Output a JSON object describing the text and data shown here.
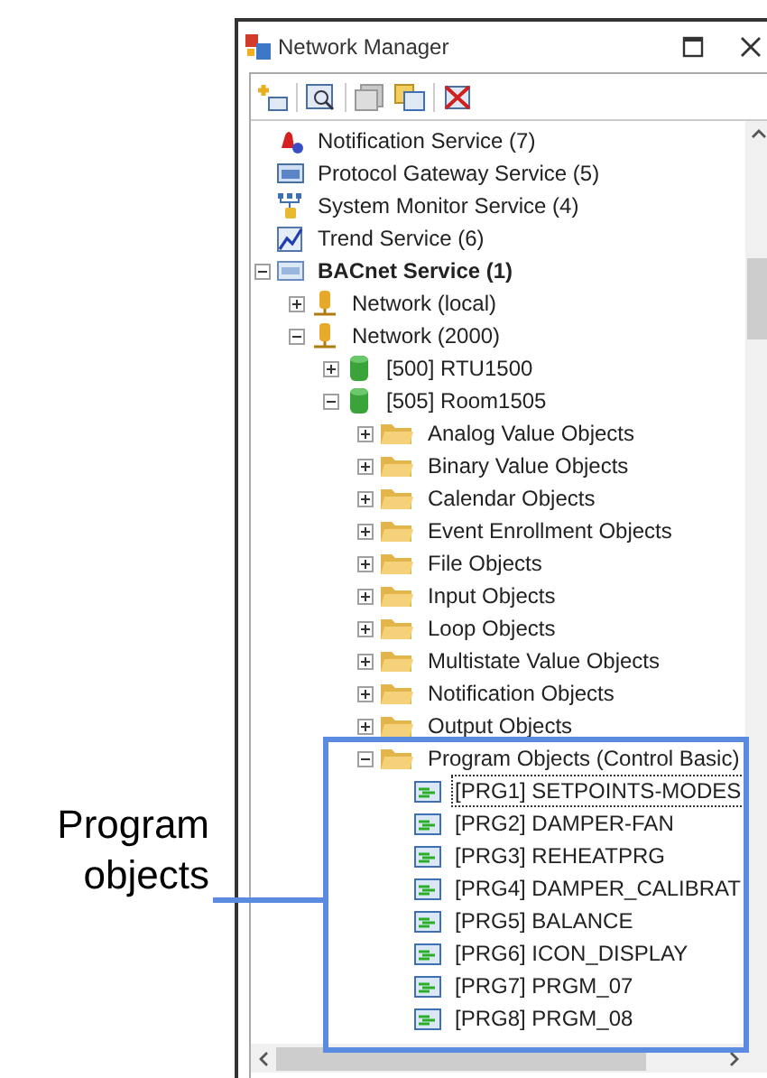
{
  "window": {
    "title": "Network Manager"
  },
  "tree": [
    {
      "label": "Notification Service (7)",
      "kind": "notification",
      "bold": false
    },
    {
      "label": "Protocol Gateway Service (5)",
      "kind": "gateway",
      "bold": false
    },
    {
      "label": "System Monitor Service (4)",
      "kind": "monitor",
      "bold": false
    },
    {
      "label": "Trend Service (6)",
      "kind": "trend",
      "bold": false
    },
    {
      "label": "BACnet Service (1)",
      "kind": "bacnet",
      "bold": true,
      "expanded": true,
      "children": [
        {
          "label": "Network (local)",
          "kind": "network",
          "expanded": false
        },
        {
          "label": "Network (2000)",
          "kind": "network",
          "expanded": true,
          "children": [
            {
              "label": "[500] RTU1500",
              "kind": "device",
              "expanded": false
            },
            {
              "label": "[505] Room1505",
              "kind": "device",
              "expanded": true,
              "children": [
                {
                  "label": "Analog Value Objects",
                  "kind": "folder",
                  "expanded": false
                },
                {
                  "label": "Binary Value Objects",
                  "kind": "folder",
                  "expanded": false
                },
                {
                  "label": "Calendar Objects",
                  "kind": "folder",
                  "expanded": false
                },
                {
                  "label": "Event Enrollment Objects",
                  "kind": "folder",
                  "expanded": false
                },
                {
                  "label": "File Objects",
                  "kind": "folder",
                  "expanded": false
                },
                {
                  "label": "Input Objects",
                  "kind": "folder",
                  "expanded": false
                },
                {
                  "label": "Loop Objects",
                  "kind": "folder",
                  "expanded": false
                },
                {
                  "label": "Multistate Value Objects",
                  "kind": "folder",
                  "expanded": false
                },
                {
                  "label": "Notification Objects",
                  "kind": "folder",
                  "expanded": false
                },
                {
                  "label": "Output Objects",
                  "kind": "folder",
                  "expanded": false
                },
                {
                  "label": "Program Objects (Control Basic)",
                  "kind": "folder",
                  "expanded": true,
                  "children": [
                    {
                      "label": "[PRG1] SETPOINTS-MODES",
                      "kind": "program",
                      "selected": true
                    },
                    {
                      "label": "[PRG2] DAMPER-FAN",
                      "kind": "program",
                      "selected": false
                    },
                    {
                      "label": "[PRG3] REHEATPRG",
                      "kind": "program",
                      "selected": false
                    },
                    {
                      "label": "[PRG4] DAMPER_CALIBRAT",
                      "kind": "program",
                      "selected": false
                    },
                    {
                      "label": "[PRG5] BALANCE",
                      "kind": "program",
                      "selected": false
                    },
                    {
                      "label": "[PRG6] ICON_DISPLAY",
                      "kind": "program",
                      "selected": false
                    },
                    {
                      "label": "[PRG7] PRGM_07",
                      "kind": "program",
                      "selected": false
                    },
                    {
                      "label": "[PRG8] PRGM_08",
                      "kind": "program",
                      "selected": false
                    }
                  ]
                }
              ]
            }
          ]
        }
      ]
    }
  ],
  "callout": {
    "label": "Program objects"
  }
}
